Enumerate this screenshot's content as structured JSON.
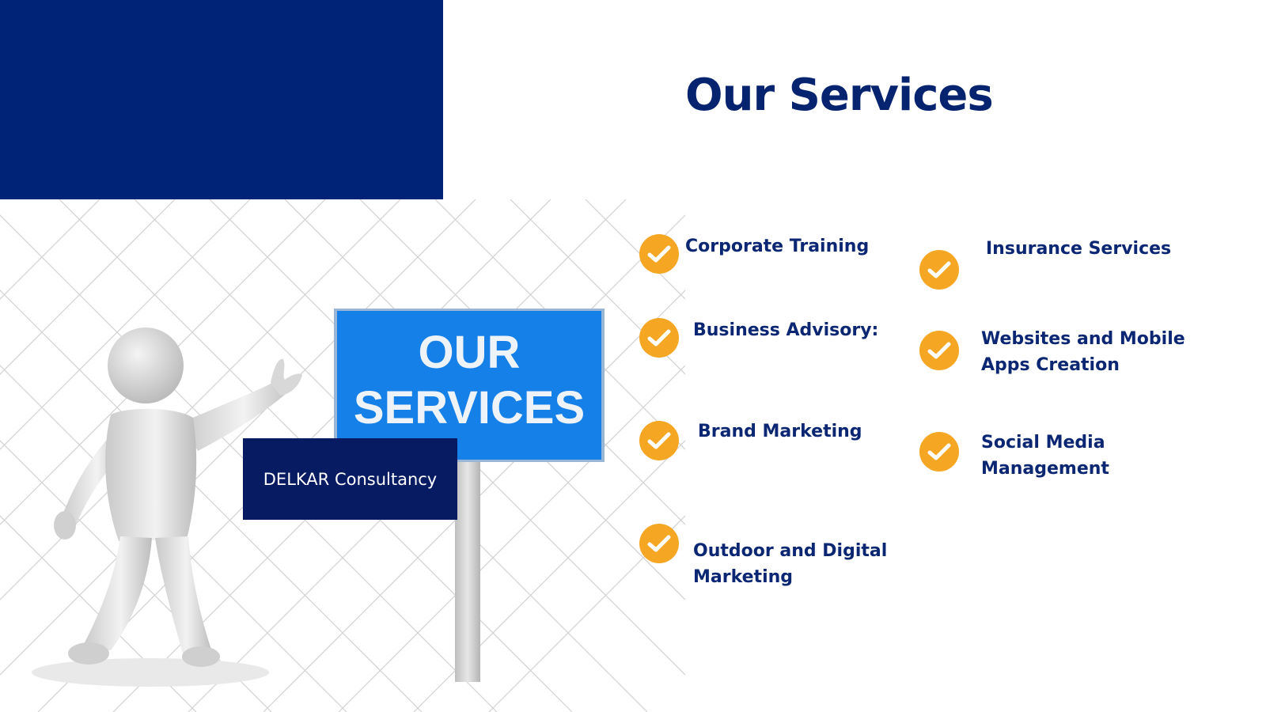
{
  "slide": {
    "title": "Our Services",
    "company_name": "DELKAR Consultancy",
    "sign": {
      "line1": "OUR",
      "line2": "SERVICES"
    }
  },
  "services": [
    {
      "line1": "Corporate Training",
      "line2": ""
    },
    {
      "line1": "Business Advisory:",
      "line2": ""
    },
    {
      "line1": "Brand Marketing",
      "line2": ""
    },
    {
      "line1": "Outdoor and Digital",
      "line2": "Marketing"
    },
    {
      "line1": "Insurance Services",
      "line2": ""
    },
    {
      "line1": "Websites and Mobile",
      "line2": "Apps Creation"
    },
    {
      "line1": "Social Media",
      "line2": "Management"
    }
  ],
  "colors": {
    "navy": "#002277",
    "title": "#06236f",
    "badge": "#071b63",
    "check": "#f5a623",
    "sign": "#1580e8"
  },
  "icons": {
    "check": "check-circle-icon"
  }
}
